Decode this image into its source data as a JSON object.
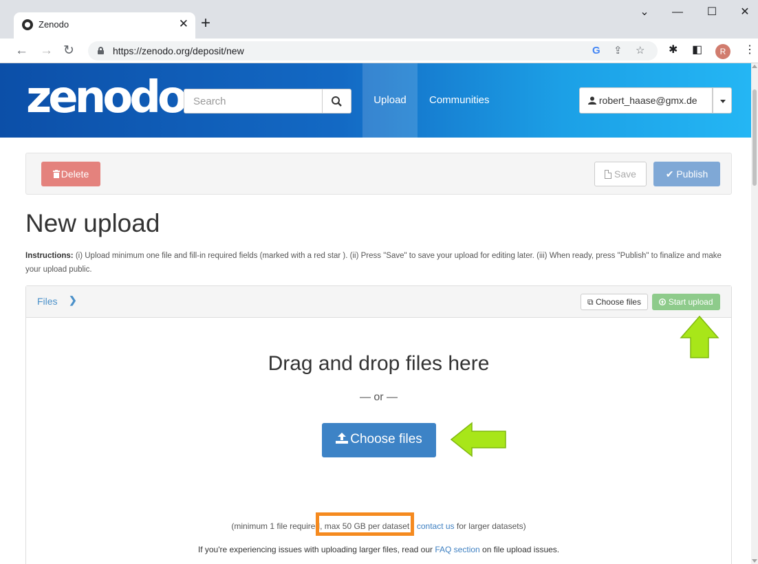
{
  "browser": {
    "tab_title": "Zenodo",
    "url": "https://zenodo.org/deposit/new",
    "profile_initial": "R"
  },
  "header": {
    "logo_text": "zenodo",
    "search_placeholder": "Search",
    "nav": {
      "upload": "Upload",
      "communities": "Communities"
    },
    "user_email": "robert_haase@gmx.de"
  },
  "actions": {
    "delete_label": "Delete",
    "save_label": "Save",
    "publish_label": "Publish"
  },
  "page": {
    "title": "New upload",
    "instructions_lead": "Instructions:",
    "instructions_text": " (i) Upload minimum one file and fill-in required fields (marked with a red star ). (ii) Press \"Save\" to save your upload for editing later. (iii) When ready, press \"Publish\" to finalize and make your upload public."
  },
  "files": {
    "panel_title": "Files",
    "choose_small_label": "Choose files",
    "start_upload_label": "Start upload",
    "drop_title": "Drag and drop files here",
    "or_text": "— or —",
    "choose_big_label": "Choose files",
    "req_prefix": "(minimum 1 file required, ",
    "req_max": "max 50 GB per dataset",
    "req_sep": " - ",
    "req_contact": "contact us",
    "req_suffix": " for larger datasets)",
    "faq_prefix": "If you're experiencing issues with uploading larger files, read our ",
    "faq_link": "FAQ section",
    "faq_suffix": " on file upload issues."
  },
  "colors": {
    "annotation_highlight": "#f58a1f",
    "annotation_arrow": "#a8e619"
  }
}
